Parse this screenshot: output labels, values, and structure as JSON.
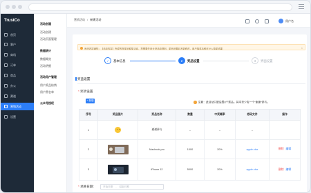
{
  "app": {
    "logo": "TrustCo",
    "user_name": "用户名"
  },
  "sidebar": {
    "items": [
      {
        "label": "首页",
        "active": false
      },
      {
        "label": "客户",
        "active": false
      },
      {
        "label": "商机",
        "active": false
      },
      {
        "label": "订单",
        "active": false
      },
      {
        "label": "商品",
        "active": false
      },
      {
        "label": "办公",
        "active": false
      },
      {
        "label": "渠道",
        "active": false
      },
      {
        "label": "营销活动",
        "active": true
      },
      {
        "label": "设置",
        "active": false
      }
    ]
  },
  "submenu": {
    "groups": [
      {
        "title": "活动创建",
        "items": [
          "活动创建",
          "活动页面管理"
        ]
      },
      {
        "title": "数据统计",
        "items": [
          "数据概览",
          "活动明细"
        ]
      },
      {
        "title": "活动用户管理",
        "items": [
          "用户奖品核销",
          "用户黑名单"
        ]
      },
      {
        "title": "公众号授权",
        "items": []
      }
    ]
  },
  "breadcrumb": {
    "parent": "营销活动",
    "separator": "/",
    "current": "新建活动"
  },
  "notice": {
    "text": "系统内容通知：【活动内容】完成的多奖品抽奖活动，您需要先设计好活动规则，奖品设置后不能修改，用户抽奖后即可计入抽奖结果",
    "close": "×"
  },
  "steps": [
    {
      "num": "✓",
      "label": "基本信息",
      "state": "done"
    },
    {
      "num": "2",
      "label": "奖品设置",
      "state": "active"
    },
    {
      "num": "3",
      "label": "界面设置",
      "state": "todo"
    }
  ],
  "section": {
    "title": "奖品设置"
  },
  "prize": {
    "label": "奖项设置",
    "add_button": "+ 新增",
    "tip": "注意：此活动只能设置8个奖品，其中至少有一个\"谢谢\"参与。",
    "columns": [
      "序号",
      "奖品图片",
      "奖品名称",
      "数量",
      "中奖概率",
      "券码文件",
      "操作"
    ],
    "rows": [
      {
        "no": "1",
        "img": "smile",
        "name": "谢谢参与",
        "qty": "--",
        "rate": "--",
        "file": "--",
        "ops": []
      },
      {
        "no": "2",
        "img": "laptop",
        "name": "Macbook pro",
        "qty": "1000",
        "rate": "20%",
        "file": "apple.xlsx",
        "ops": [
          "删除",
          "编辑"
        ]
      },
      {
        "no": "3",
        "img": "phone",
        "name": "iPhone 12",
        "qty": "5000",
        "rate": "20%",
        "file": "apple.xlsx",
        "ops": [
          "删除",
          "编辑"
        ]
      }
    ]
  },
  "redeem": {
    "label": "兑换日期:",
    "start_placeholder": "开始日期",
    "sep": "-",
    "end_placeholder": "结束日期"
  },
  "colors": {
    "primary": "#2c7ef8",
    "sidebar": "#1e2a38",
    "danger": "#f04848",
    "warn": "#f3a53a"
  }
}
